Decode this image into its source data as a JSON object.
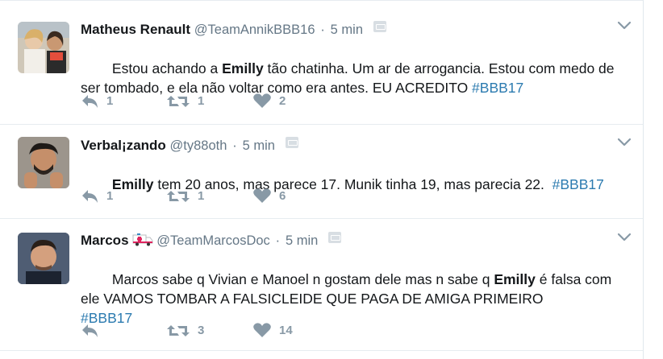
{
  "tweets": [
    {
      "name": "Matheus Renault",
      "handle": "@TeamAnnikBBB16",
      "separator": "·",
      "time": "5 min",
      "text_parts": [
        {
          "t": "Estou achando a ",
          "style": "normal"
        },
        {
          "t": "Emilly",
          "style": "bold"
        },
        {
          "t": " tão chatinha. Um ar de arrogancia. Estou com medo de ser tombado, e ela não voltar como era antes. EU ACREDITO ",
          "style": "normal"
        },
        {
          "t": "#BBB17",
          "style": "hashtag"
        }
      ],
      "reply_count": "1",
      "retweet_count": "1",
      "like_count": "2"
    },
    {
      "name": "Verbal¡zando",
      "handle": "@ty88oth",
      "separator": "·",
      "time": "5 min",
      "text_parts": [
        {
          "t": "Emilly",
          "style": "bold"
        },
        {
          "t": " tem 20 anos, mas parece 17. Munik tinha 19, mas parecia 22.  ",
          "style": "normal"
        },
        {
          "t": "#BBB17",
          "style": "hashtag"
        }
      ],
      "reply_count": "1",
      "retweet_count": "1",
      "like_count": "6"
    },
    {
      "name": "Marcos",
      "handle": "@TeamMarcosDoc",
      "separator": "·",
      "time": "5 min",
      "text_parts": [
        {
          "t": "Marcos sabe q Vivian e Manoel n gostam dele mas n sabe q ",
          "style": "normal"
        },
        {
          "t": "Emilly",
          "style": "bold"
        },
        {
          "t": " é falsa com ele VAMOS TOMBAR A FALSICLEIDE QUE PAGA DE AMIGA PRIMEIRO\n",
          "style": "normal"
        },
        {
          "t": "#BBB17",
          "style": "hashtag"
        }
      ],
      "reply_count": "",
      "retweet_count": "3",
      "like_count": "14"
    }
  ],
  "icons": {
    "reply": "reply-icon",
    "retweet": "retweet-icon",
    "like": "heart-icon",
    "more": "chevron-down-icon",
    "ambulance": "ambulance-emoji-icon"
  },
  "colors": {
    "hashtag": "#2c7bb0",
    "muted": "#657786",
    "action": "#8899a6"
  }
}
